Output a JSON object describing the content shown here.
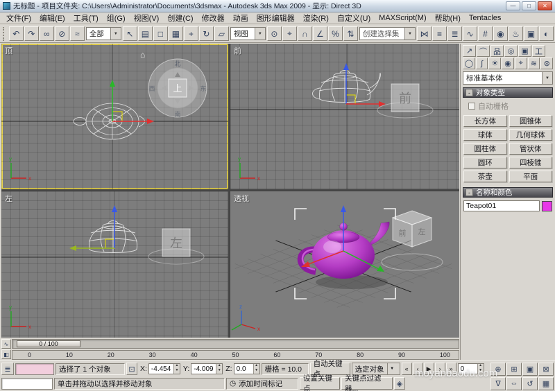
{
  "colors": {
    "active_viewport_border": "#e8d44d",
    "viewport_background": "#7d7d7d",
    "teapot_shaded": "#b43cc4",
    "object_color_swatch": "#e838e8",
    "gizmo_x_axis": "#e03030",
    "gizmo_y_axis": "#28b828",
    "gizmo_z_axis": "#3858e8"
  },
  "icons": {
    "chevron_down": "▼",
    "spin_up": "▲",
    "spin_down": "▼",
    "collapse": "-",
    "home": "⌂",
    "clock": "◷",
    "axis_x": "x",
    "axis_y": "y",
    "axis_z": "z"
  },
  "titlebar": {
    "title": "无标题 - 项目文件夹: C:\\Users\\Administrator\\Documents\\3dsmax  - Autodesk 3ds Max  2009  - 显示: Direct 3D",
    "minimize_glyph": "—",
    "maximize_glyph": "□",
    "close_glyph": "✕"
  },
  "menu": {
    "items": [
      "文件(F)",
      "编辑(E)",
      "工具(T)",
      "组(G)",
      "视图(V)",
      "创建(C)",
      "修改器",
      "动画",
      "图形编辑器",
      "渲染(R)",
      "自定义(U)",
      "MAXScript(M)",
      "帮助(H)",
      "Tentacles"
    ]
  },
  "toolbar": {
    "selection_filter": "全部",
    "coord_system": "视图",
    "named_sets_placeholder": "创建选择集",
    "icons_left": [
      {
        "name": "undo-icon",
        "glyph": "↶"
      },
      {
        "name": "redo-icon",
        "glyph": "↷"
      },
      {
        "name": "select-and-link-icon",
        "glyph": "∞"
      },
      {
        "name": "unlink-selection-icon",
        "glyph": "⊘"
      },
      {
        "name": "bind-to-space-warp-icon",
        "glyph": "≈"
      }
    ],
    "icons_mid": [
      {
        "name": "select-object-icon",
        "glyph": "↖"
      },
      {
        "name": "select-by-name-icon",
        "glyph": "▤"
      },
      {
        "name": "rectangular-selection-region-icon",
        "glyph": "□"
      },
      {
        "name": "window-crossing-icon",
        "glyph": "▦"
      },
      {
        "name": "select-and-move-icon",
        "glyph": "+"
      },
      {
        "name": "select-and-rotate-icon",
        "glyph": "↻"
      },
      {
        "name": "select-and-scale-icon",
        "glyph": "▱"
      }
    ],
    "icons_mid2": [
      {
        "name": "use-pivot-center-icon",
        "glyph": "⊙"
      },
      {
        "name": "select-and-manipulate-icon",
        "glyph": "⌖"
      },
      {
        "name": "snap-toggle-icon",
        "glyph": "∩"
      },
      {
        "name": "angle-snap-icon",
        "glyph": "∠"
      },
      {
        "name": "percent-snap-icon",
        "glyph": "%"
      },
      {
        "name": "spinner-snap-icon",
        "glyph": "⇅"
      }
    ],
    "icons_right": [
      {
        "name": "mirror-icon",
        "glyph": "⋈"
      },
      {
        "name": "align-icon",
        "glyph": "≡"
      },
      {
        "name": "layer-manager-icon",
        "glyph": "≣"
      },
      {
        "name": "curve-editor-icon",
        "glyph": "∿"
      },
      {
        "name": "schematic-view-icon",
        "glyph": "#"
      },
      {
        "name": "material-editor-icon",
        "glyph": "◉"
      },
      {
        "name": "render-setup-icon",
        "glyph": "♨"
      },
      {
        "name": "rendered-frame-window-icon",
        "glyph": "▣"
      },
      {
        "name": "quick-render-icon",
        "glyph": "◐"
      }
    ]
  },
  "viewports": {
    "top_label": "顶",
    "front_label": "前",
    "left_label": "左",
    "persp_label": "透视",
    "viewcube": {
      "up": "上",
      "north": "北",
      "south": "南",
      "east": "东",
      "west": "西",
      "front": "前",
      "left": "左"
    }
  },
  "command_panel": {
    "tabs": [
      {
        "name": "tab-create-icon",
        "glyph": "↗"
      },
      {
        "name": "tab-modify-icon",
        "glyph": "⌒"
      },
      {
        "name": "tab-hierarchy-icon",
        "glyph": "品"
      },
      {
        "name": "tab-motion-icon",
        "glyph": "◎"
      },
      {
        "name": "tab-display-icon",
        "glyph": "▣"
      },
      {
        "name": "tab-utilities-icon",
        "glyph": "工"
      }
    ],
    "subtabs": [
      {
        "name": "subtab-geometry-icon",
        "glyph": "◯"
      },
      {
        "name": "subtab-shapes-icon",
        "glyph": "∫"
      },
      {
        "name": "subtab-lights-icon",
        "glyph": "☀"
      },
      {
        "name": "subtab-cameras-icon",
        "glyph": "◉"
      },
      {
        "name": "subtab-helpers-icon",
        "glyph": "⌖"
      },
      {
        "name": "subtab-space-warps-icon",
        "glyph": "≋"
      },
      {
        "name": "subtab-systems-icon",
        "glyph": "⊛"
      }
    ],
    "category": "标准基本体",
    "rollout_object_type": "对象类型",
    "autogrid_label": "自动栅格",
    "object_buttons": [
      {
        "name": "box-button",
        "label": "长方体"
      },
      {
        "name": "cone-button",
        "label": "圆锥体"
      },
      {
        "name": "sphere-button",
        "label": "球体"
      },
      {
        "name": "geosphere-button",
        "label": "几何球体"
      },
      {
        "name": "cylinder-button",
        "label": "圆柱体"
      },
      {
        "name": "tube-button",
        "label": "管状体"
      },
      {
        "name": "torus-button",
        "label": "圆环"
      },
      {
        "name": "pyramid-button",
        "label": "四棱锥"
      },
      {
        "name": "teapot-button",
        "label": "茶壶"
      },
      {
        "name": "plane-button",
        "label": "平面"
      }
    ],
    "rollout_name_color": "名称和颜色",
    "object_name": "Teapot01"
  },
  "timeline": {
    "slider_label": "0 / 100"
  },
  "trackbar": {
    "ticks": [
      "0",
      "10",
      "20",
      "30",
      "40",
      "50",
      "60",
      "70",
      "80",
      "90",
      "100"
    ]
  },
  "status": {
    "selection_info": "选择了 1 个对象",
    "x_label": "X:",
    "x_value": "-4.454",
    "y_label": "Y:",
    "y_value": "-4.009",
    "z_label": "Z:",
    "z_value": "0.0",
    "grid_info": "栅格 = 10.0",
    "auto_key": "自动关键点",
    "set_key": "设置关键点",
    "selected_dropdown": "选定对象",
    "key_filters": "关键点过滤器...",
    "frame": "0",
    "prompt": "单击并拖动以选择并移动对象",
    "add_time_tag": "添加时间标记",
    "watermark": "moyanbaodu.com",
    "left_icon": {
      "name": "maxscript-listener-icon",
      "glyph": "≣"
    },
    "lock_icon": {
      "name": "selection-lock-icon",
      "glyph": "⊡"
    },
    "key_mode_icon": {
      "name": "key-mode-toggle-icon",
      "glyph": "◈"
    },
    "transport": [
      {
        "name": "go-to-start-button",
        "glyph": "«"
      },
      {
        "name": "previous-frame-button",
        "glyph": "‹"
      },
      {
        "name": "play-button",
        "glyph": "▶"
      },
      {
        "name": "next-frame-button",
        "glyph": "›"
      },
      {
        "name": "go-to-end-button",
        "glyph": "»"
      }
    ],
    "nav_row1": [
      {
        "name": "zoom-icon",
        "glyph": "⊕"
      },
      {
        "name": "zoom-all-icon",
        "glyph": "⊞"
      },
      {
        "name": "zoom-extents-icon",
        "glyph": "▣"
      },
      {
        "name": "zoom-extents-all-icon",
        "glyph": "⊠"
      }
    ],
    "nav_row2": [
      {
        "name": "field-of-view-icon",
        "glyph": "∇"
      },
      {
        "name": "pan-icon",
        "glyph": "⇔"
      },
      {
        "name": "arc-rotate-icon",
        "glyph": "↺"
      },
      {
        "name": "maximize-viewport-icon",
        "glyph": "▦"
      }
    ],
    "trackbar_left_icons": [
      {
        "name": "mini-curve-editor-icon",
        "glyph": "∿"
      },
      {
        "name": "track-selection-icon",
        "glyph": "◧"
      }
    ]
  }
}
